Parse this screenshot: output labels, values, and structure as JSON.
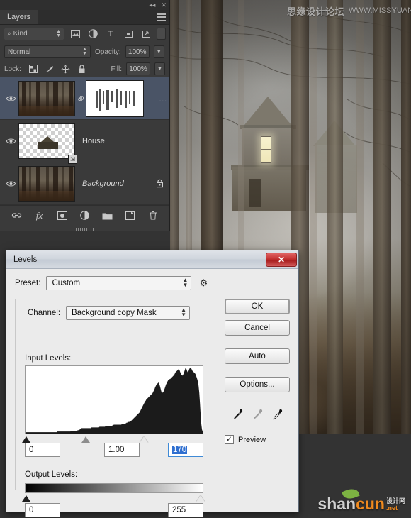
{
  "layers_panel": {
    "tab_label": "Layers",
    "topbar": {
      "collapse_icon": "collapse-double-arrow-icon",
      "close_icon": "close-icon"
    },
    "panel_menu_icon": "panel-menu-icon",
    "filter": {
      "kind_label": "Kind",
      "search_icon": "search-icon",
      "icons": [
        "pixel-filter-icon",
        "adjustment-filter-icon",
        "type-filter-icon",
        "shape-filter-icon",
        "smart-object-filter-icon"
      ],
      "toggle_icon": "filter-toggle-icon"
    },
    "blend": {
      "mode": "Normal",
      "opacity_label": "Opacity:",
      "opacity_value": "100%"
    },
    "lock": {
      "label": "Lock:",
      "icons": [
        "lock-transparency-icon",
        "lock-image-icon",
        "lock-position-icon",
        "lock-all-icon"
      ],
      "fill_label": "Fill:",
      "fill_value": "100%"
    },
    "layers": [
      {
        "name": "",
        "visible_icon": "eye-icon",
        "type": "masked",
        "selected": true,
        "linked": true,
        "dots": "..."
      },
      {
        "name": "House",
        "visible_icon": "eye-icon",
        "type": "transparent",
        "selected": false,
        "linked": false
      },
      {
        "name": "Background",
        "visible_icon": "eye-icon",
        "type": "forest",
        "selected": false,
        "locked": true,
        "lock_icon": "lock-icon"
      }
    ],
    "footer_icons": [
      "link-layers-icon",
      "layer-style-fx-icon",
      "add-mask-icon",
      "new-adjustment-layer-icon",
      "new-group-icon",
      "new-layer-icon",
      "delete-layer-icon"
    ]
  },
  "levels_dialog": {
    "title": "Levels",
    "close_label": "✕",
    "preset_label": "Preset:",
    "preset_value": "Custom",
    "preset_gear_icon": "gear-icon",
    "channel_label": "Channel:",
    "channel_value": "Background copy Mask",
    "input_levels_label": "Input Levels:",
    "input_black": "0",
    "input_gamma": "1.00",
    "input_white": "170",
    "output_levels_label": "Output Levels:",
    "output_black": "0",
    "output_white": "255",
    "buttons": {
      "ok": "OK",
      "cancel": "Cancel",
      "auto": "Auto",
      "options": "Options..."
    },
    "eyedroppers": [
      "set-black-point-eyedropper-icon",
      "set-gray-point-eyedropper-icon",
      "set-white-point-eyedropper-icon"
    ],
    "preview_label": "Preview",
    "preview_checked": true,
    "histogram": {
      "description": "mask-channel-histogram",
      "bins": [
        2,
        2,
        2,
        2,
        2,
        2,
        2,
        2,
        2,
        2,
        2,
        2,
        2,
        2,
        2,
        2,
        2,
        2,
        2,
        2,
        2,
        2,
        2,
        2,
        2,
        2,
        2,
        2,
        2,
        2,
        2,
        2,
        2,
        2,
        2,
        2,
        2,
        2,
        2,
        2,
        2,
        2,
        2,
        2,
        2,
        2,
        2,
        3,
        3,
        3,
        3,
        3,
        3,
        3,
        3,
        3,
        3,
        3,
        3,
        3,
        3,
        3,
        3,
        3,
        3,
        3,
        3,
        4,
        4,
        4,
        4,
        4,
        4,
        4,
        4,
        4,
        4,
        5,
        5,
        5,
        6,
        7,
        8,
        8,
        8,
        8,
        8,
        8,
        8,
        8,
        8,
        8,
        8,
        8,
        8,
        8,
        8,
        9,
        9,
        9,
        9,
        9,
        9,
        9,
        9,
        9,
        9,
        9,
        9,
        10,
        10,
        10,
        10,
        10,
        10,
        10,
        10,
        10,
        11,
        11,
        11,
        11,
        11,
        11,
        11,
        11,
        11,
        11,
        12,
        12,
        13,
        13,
        13,
        13,
        13,
        13,
        13,
        13,
        13,
        13,
        13,
        13,
        14,
        14,
        14,
        14,
        14,
        15,
        15,
        16,
        16,
        17,
        17,
        17,
        18,
        18,
        19,
        20,
        21,
        22,
        23,
        24,
        25,
        26,
        27,
        28,
        29,
        30,
        31,
        33,
        35,
        37,
        39,
        41,
        43,
        45,
        47,
        48,
        50,
        51,
        52,
        53,
        54,
        55,
        56,
        57,
        58,
        59,
        61,
        63,
        65,
        68,
        70,
        72,
        73,
        74,
        75,
        73,
        70,
        66,
        62,
        60,
        60,
        61,
        63,
        66,
        69,
        72,
        74,
        76,
        78,
        79,
        80,
        80,
        81,
        82,
        83,
        84,
        85,
        86,
        88,
        90,
        91,
        92,
        93,
        94,
        95,
        93,
        90,
        88,
        86,
        85,
        86,
        88,
        91,
        94,
        97,
        95,
        92,
        90,
        91,
        94,
        96,
        97,
        96,
        94,
        92,
        91,
        90,
        89,
        88,
        86,
        83,
        80,
        76,
        70,
        60,
        45,
        28,
        14,
        6,
        3
      ]
    }
  },
  "canvas": {
    "image_description": "foggy-forest-with-house",
    "watermark_top_cn": "思缘设计论坛",
    "watermark_top_url": "WWW.MISSYUAN.COM",
    "logo_main": "shan",
    "logo_accent": "cun",
    "logo_tag_top": "设计网",
    "logo_tag_bottom": ".net"
  },
  "colors": {
    "panel_bg": "#3a3a3a",
    "panel_selected": "#4a5466",
    "dialog_bg": "#ebebeb",
    "close_red": "#c33030",
    "selection_blue": "#2f6fd0",
    "desktop_bg": "#333333"
  }
}
